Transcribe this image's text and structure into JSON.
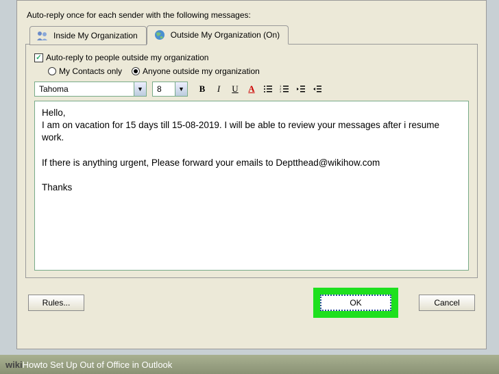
{
  "header": {
    "label": "Auto-reply once for each sender with the following messages:"
  },
  "tabs": {
    "inside": {
      "label": "Inside My Organization"
    },
    "outside": {
      "label": "Outside My Organization (On)"
    }
  },
  "options": {
    "checkbox_label": "Auto-reply to people outside my organization",
    "checkbox_checked": true,
    "radios": {
      "contacts": "My Contacts only",
      "anyone": "Anyone outside my organization"
    }
  },
  "toolbar": {
    "font": "Tahoma",
    "size": "8",
    "bold": "B",
    "italic": "I",
    "underline": "U",
    "color": "A"
  },
  "editor": {
    "body": "Hello,\nI am on vacation for 15 days till 15-08-2019. I will be able to review your messages after i resume work.\n\nIf there is anything urgent, Please forward your emails to Deptthead@wikihow.com\n\nThanks"
  },
  "buttons": {
    "rules": "Rules...",
    "ok": "OK",
    "cancel": "Cancel"
  },
  "caption": {
    "brand_pre": "wiki",
    "brand_post": "How",
    "text": " to Set Up Out of Office in Outlook"
  }
}
